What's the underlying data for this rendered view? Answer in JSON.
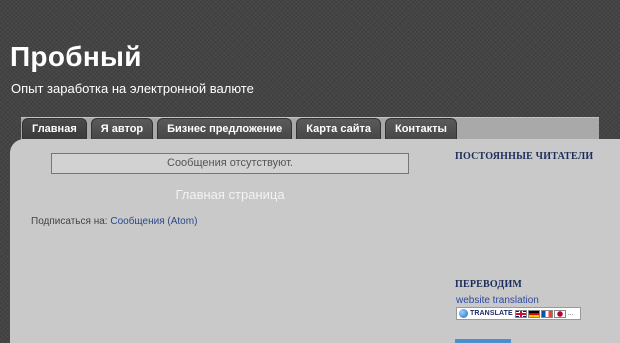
{
  "header": {
    "title": "Пробный",
    "description": "Опыт заработка на электронной валюте"
  },
  "nav": {
    "tabs": [
      {
        "label": "Главная"
      },
      {
        "label": "Я автор"
      },
      {
        "label": "Бизнес предложение"
      },
      {
        "label": "Карта сайта"
      },
      {
        "label": "Контакты"
      }
    ]
  },
  "main": {
    "notice": "Сообщения отсутствуют.",
    "page_title": "Главная страница",
    "subscribe_prefix": "Подписаться на:",
    "subscribe_link": "Сообщения (Atom)"
  },
  "sidebar": {
    "followers_title": "ПОСТОЯННЫЕ ЧИТАТЕЛИ",
    "translate_title": "ПЕРЕВОДИМ",
    "translate_link": "website translation",
    "translate_button": "TRANSLATE",
    "flags": [
      "uk-flag-icon",
      "de-flag-icon",
      "fr-flag-icon",
      "jp-flag-icon"
    ]
  },
  "colors": {
    "background": "#444444",
    "tab": "#4f4f4f",
    "content": "#c9c9c9",
    "link": "#2a4a8a",
    "sidebar_heading": "#1c2d5a"
  }
}
